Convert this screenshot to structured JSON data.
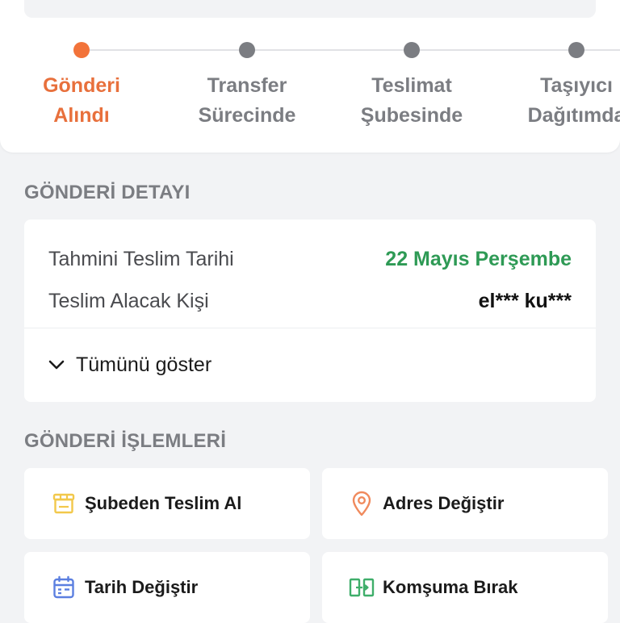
{
  "stepper": {
    "steps": [
      {
        "line1": "Gönderi",
        "line2": "Alındı"
      },
      {
        "line1": "Transfer",
        "line2": "Sürecinde"
      },
      {
        "line1": "Teslimat",
        "line2": "Şubesinde"
      },
      {
        "line1": "Taşıyıcı",
        "line2": "Dağıtımda"
      }
    ],
    "active_index": 0,
    "active_color": "#e8703c"
  },
  "detail": {
    "section_title": "GÖNDERİ DETAYI",
    "rows": [
      {
        "label": "Tahmini Teslim Tarihi",
        "value": "22 Mayıs Perşembe"
      },
      {
        "label": "Teslim Alacak Kişi",
        "value": "el*** ku***"
      }
    ],
    "show_all_label": "Tümünü göster"
  },
  "actions": {
    "section_title": "GÖNDERİ İŞLEMLERİ",
    "items": [
      {
        "label": "Şubeden Teslim Al",
        "icon": "store-icon",
        "color": "#f2c84b"
      },
      {
        "label": "Adres Değiştir",
        "icon": "location-pin-icon",
        "color": "#f08a5d"
      },
      {
        "label": "Tarih Değiştir",
        "icon": "calendar-icon",
        "color": "#5b7fe0"
      },
      {
        "label": "Komşuma Bırak",
        "icon": "neighbor-transfer-icon",
        "color": "#3fae6a"
      }
    ]
  }
}
